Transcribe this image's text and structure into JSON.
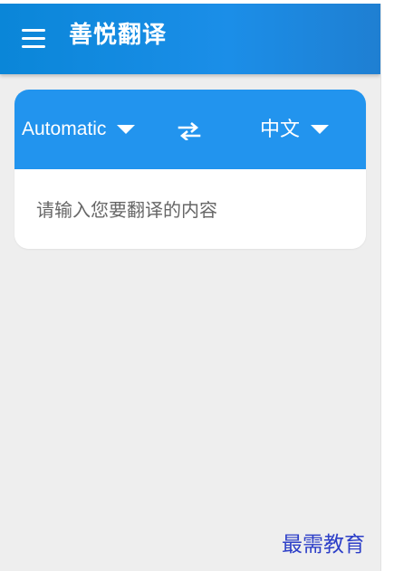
{
  "app": {
    "title": "善悦翻译"
  },
  "translator": {
    "source_language": "Automatic",
    "target_language": "中文",
    "swap_icon": "swap-horizontal-icon",
    "input_value": "",
    "input_placeholder": "请输入您要翻译的内容"
  },
  "watermark": {
    "text": "最需教育"
  },
  "colors": {
    "toolbar": "#0A86D8",
    "language_bar": "#2294EE",
    "background": "#EEEEEE",
    "card": "#FFFFFF",
    "watermark": "#2D3FC8"
  },
  "icons": {
    "menu": "menu-icon",
    "source_dropdown": "dropdown-triangle-icon",
    "target_dropdown": "dropdown-triangle-icon"
  }
}
